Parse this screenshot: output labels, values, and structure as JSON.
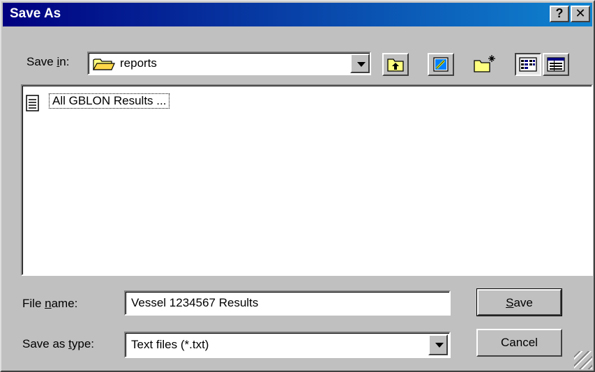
{
  "window": {
    "title": "Save As"
  },
  "caption_buttons": {
    "help": "?",
    "close": "✕"
  },
  "toolbar": {
    "save_in_label": "Save in:",
    "save_in_value": "reports",
    "icons": [
      "up-one-level-icon",
      "desktop-icon",
      "create-new-folder-icon",
      "list-view-icon",
      "details-view-icon"
    ]
  },
  "file_list": {
    "items": [
      {
        "label": "All GBLON Results ...",
        "icon": "text-document-icon"
      }
    ]
  },
  "form": {
    "file_name_label": "File name:",
    "file_name_value": "Vessel 1234567 Results",
    "save_as_type_label": "Save as type:",
    "save_as_type_value": "Text files (*.txt)"
  },
  "buttons": {
    "save": "Save",
    "cancel": "Cancel"
  },
  "colors": {
    "titlebar_start": "#000080",
    "titlebar_end": "#1084d0",
    "face": "#c0c0c0"
  }
}
